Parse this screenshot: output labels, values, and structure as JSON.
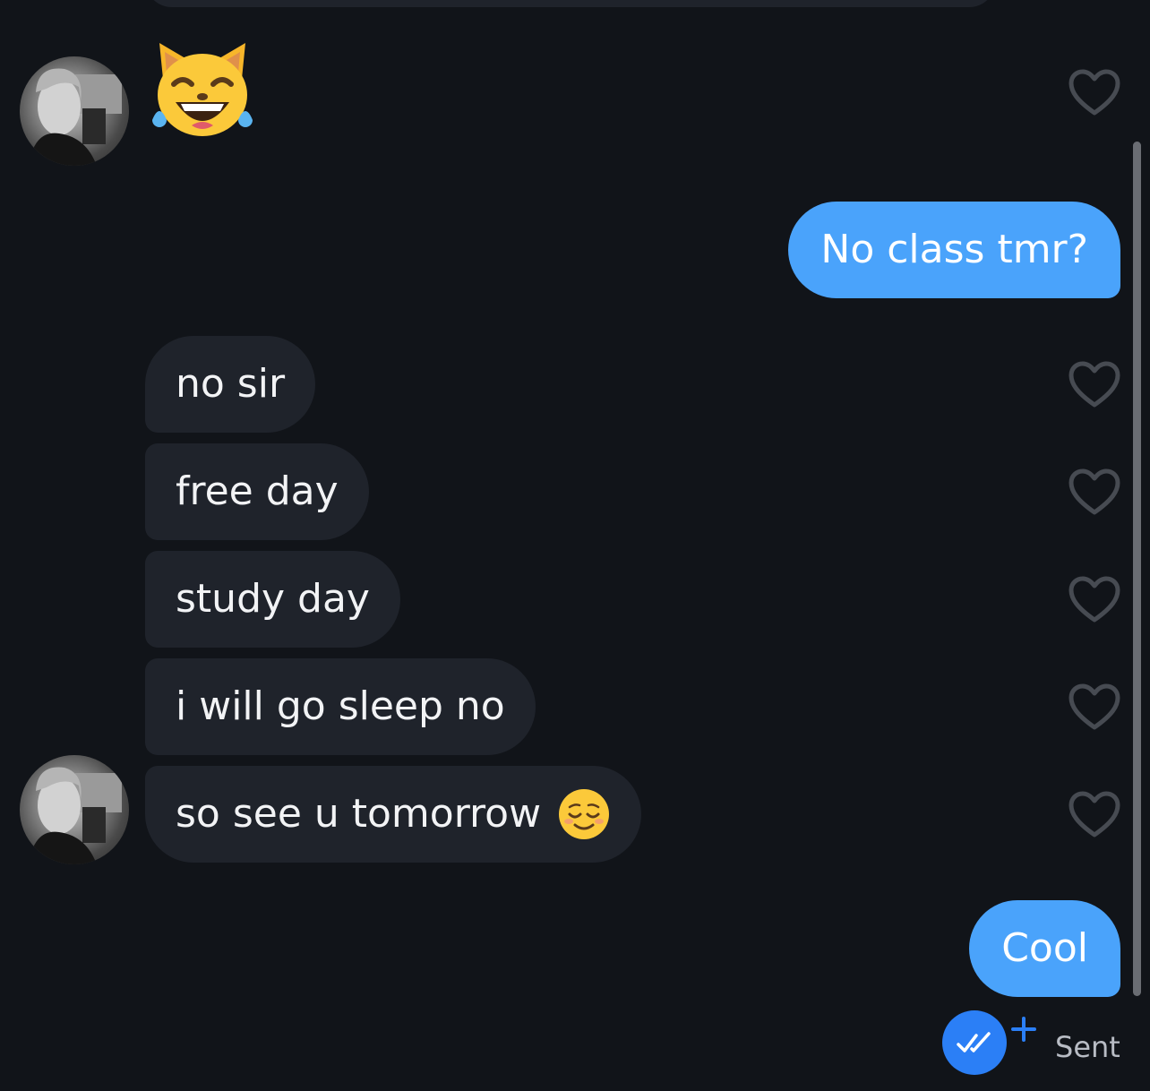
{
  "messages": {
    "m1": "No class tmr?",
    "m2": "no sir",
    "m3": "free day",
    "m4": "study day",
    "m5": "i will go sleep no",
    "m6": "so see u tomorrow",
    "m7": "Cool"
  },
  "status": "Sent",
  "icons": {
    "reaction": "cat-with-tears-of-joy-emoji",
    "inline": "relieved-face-emoji",
    "like": "heart-outline-icon",
    "read": "double-check-icon",
    "add": "plus-icon"
  },
  "colors": {
    "background": "#111419",
    "incoming_bubble": "#1f232b",
    "outgoing_bubble": "#4aa3fb",
    "read_indicator": "#2b7ff6"
  }
}
